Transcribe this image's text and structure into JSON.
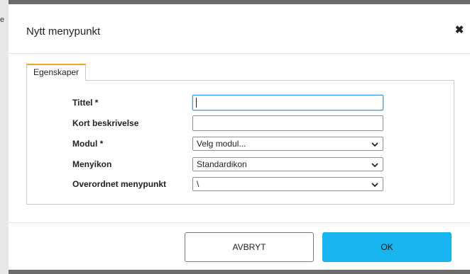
{
  "background": {
    "edge_glyph": "e"
  },
  "dialog": {
    "title": "Nytt menypunkt",
    "close_icon": "close-x-icon"
  },
  "tabs": [
    {
      "label": "Egenskaper",
      "active": true
    }
  ],
  "form": {
    "title_label": "Tittel *",
    "title_value": "",
    "short_desc_label": "Kort beskrivelse",
    "short_desc_value": "",
    "module_label": "Modul *",
    "module_selected": "Velg modul...",
    "menu_icon_label": "Menyikon",
    "menu_icon_selected": "Standardikon",
    "parent_label": "Overordnet menypunkt",
    "parent_selected": "\\"
  },
  "footer": {
    "cancel_label": "AVBRYT",
    "ok_label": "OK"
  },
  "colors": {
    "primary": "#17b4ef",
    "tab_accent": "#f5a623",
    "focus": "#3aa3e3"
  }
}
